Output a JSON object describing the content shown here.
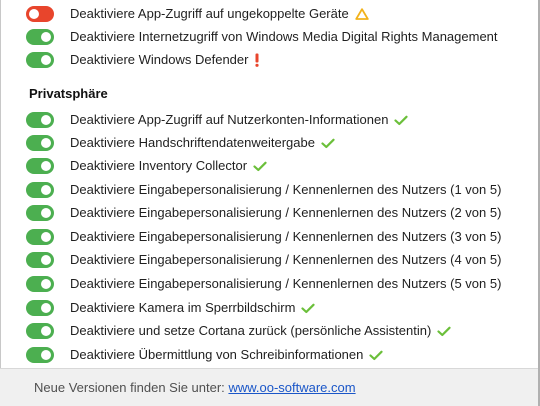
{
  "settings": [
    {
      "label": "Deaktiviere App-Zugriff auf ungekoppelte Geräte",
      "state": "off",
      "status": "warning-triangle-icon"
    },
    {
      "label": "Deaktiviere Internetzugriff von Windows Media Digital Rights Management",
      "state": "on",
      "status": ""
    },
    {
      "label": "Deaktiviere Windows Defender",
      "state": "on",
      "status": "exclamation-icon"
    }
  ],
  "privacy": {
    "title": "Privatsphäre",
    "items": [
      {
        "label": "Deaktiviere App-Zugriff auf Nutzerkonten-Informationen",
        "state": "on",
        "status": "checkmark-icon"
      },
      {
        "label": "Deaktiviere Handschriftendatenweitergabe",
        "state": "on",
        "status": "checkmark-icon"
      },
      {
        "label": "Deaktiviere Inventory Collector",
        "state": "on",
        "status": "checkmark-icon"
      },
      {
        "label": "Deaktiviere Eingabepersonalisierung / Kennenlernen des Nutzers (1 von 5)",
        "state": "on",
        "status": ""
      },
      {
        "label": "Deaktiviere Eingabepersonalisierung / Kennenlernen des Nutzers (2 von 5)",
        "state": "on",
        "status": ""
      },
      {
        "label": "Deaktiviere Eingabepersonalisierung / Kennenlernen des Nutzers (3 von 5)",
        "state": "on",
        "status": ""
      },
      {
        "label": "Deaktiviere Eingabepersonalisierung / Kennenlernen des Nutzers (4 von 5)",
        "state": "on",
        "status": ""
      },
      {
        "label": "Deaktiviere Eingabepersonalisierung / Kennenlernen des Nutzers (5 von 5)",
        "state": "on",
        "status": ""
      },
      {
        "label": "Deaktiviere Kamera im Sperrbildschirm",
        "state": "on",
        "status": "checkmark-icon"
      },
      {
        "label": "Deaktiviere und setze Cortana zurück (persönliche Assistentin)",
        "state": "on",
        "status": "checkmark-icon"
      },
      {
        "label": "Deaktiviere Übermittlung von Schreibinformationen",
        "state": "on",
        "status": "checkmark-icon"
      }
    ]
  },
  "footer": {
    "text": "Neue Versionen finden Sie unter:",
    "link": "www.oo-software.com"
  },
  "colors": {
    "toggle_on": "#4caf50",
    "toggle_off": "#e8452c",
    "check": "#6bbf3a",
    "warning": "#f2b21b",
    "exclamation": "#e8452c",
    "link": "#1a56c8"
  }
}
